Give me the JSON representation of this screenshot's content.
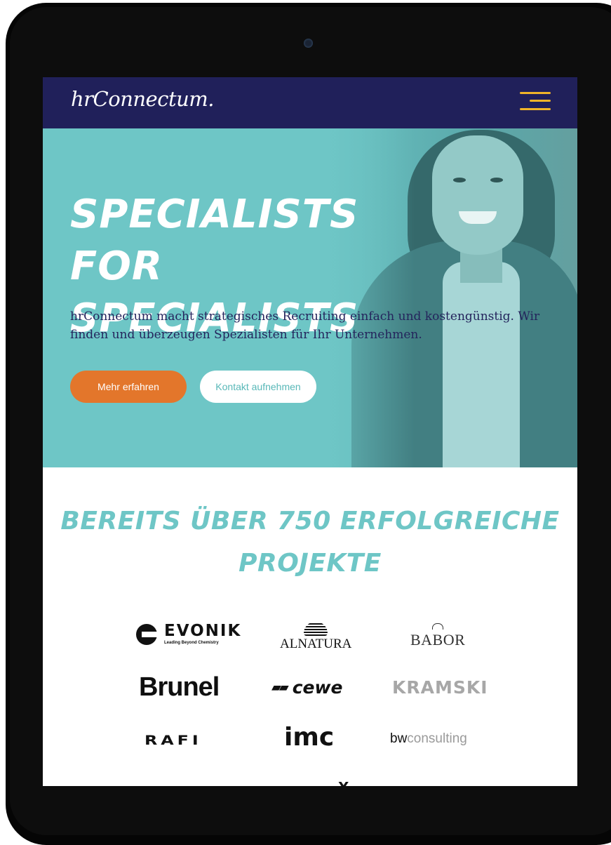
{
  "nav": {
    "logo": "hrConnectum.",
    "menu_icon": "hamburger-menu-icon",
    "menu_color": "#f0b429"
  },
  "hero": {
    "title_line1": "SPECIALISTS FOR",
    "title_line2": "SPECIALISTS",
    "text": "hrConnectum macht strategisches Recruiting einfach und kostengünstig. Wir finden und überzeugen Spezialisten für Ihr Unternehmen.",
    "primary_button": "Mehr erfahren",
    "secondary_button": "Kontakt aufnehmen"
  },
  "references": {
    "title_line1": "BEREITS ÜBER 750 ERFOLGREICHE",
    "title_line2": "PROJEKTE",
    "logos": [
      {
        "name": "EVONIK",
        "tagline": "Leading Beyond Chemistry"
      },
      {
        "name": "ALNATURA"
      },
      {
        "name": "BABOR"
      },
      {
        "name": "Brunel"
      },
      {
        "name": "cewe"
      },
      {
        "name": "KRAMSKI"
      },
      {
        "name": "RAFI"
      },
      {
        "name": "imc"
      },
      {
        "name_part1": "bw",
        "name_part2": "consulting"
      },
      {
        "name": "X"
      }
    ]
  },
  "colors": {
    "navy": "#20205a",
    "teal": "#6ec6c6",
    "orange": "#e3762b"
  }
}
